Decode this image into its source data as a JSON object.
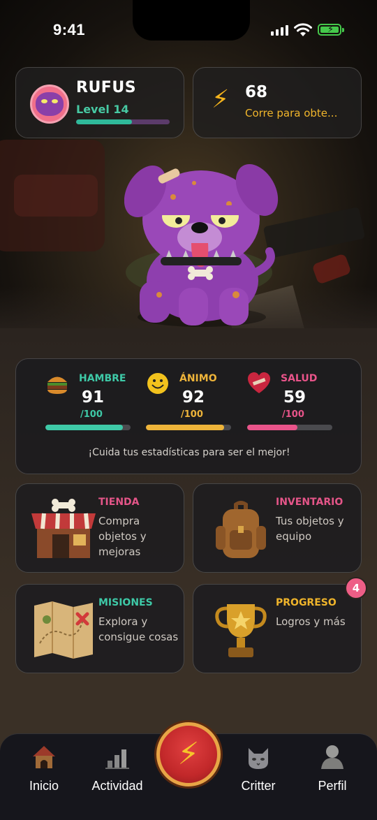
{
  "status_bar": {
    "time": "9:41"
  },
  "pet": {
    "name": "RUFUS",
    "level_label": "Level 14",
    "level_progress": 0.6
  },
  "energy": {
    "value": "68",
    "subtitle": "Corre para obte..."
  },
  "stats": [
    {
      "label": "HAMBRE",
      "value": "91",
      "max": "/100",
      "fraction": 0.91,
      "color": "#3ec9a7",
      "icon": "burger-icon"
    },
    {
      "label": "ÁNIMO",
      "value": "92",
      "max": "/100",
      "fraction": 0.92,
      "color": "#eeb43a",
      "icon": "smiley-icon"
    },
    {
      "label": "SALUD",
      "value": "59",
      "max": "/100",
      "fraction": 0.59,
      "color": "#e9548a",
      "icon": "heart-icon"
    }
  ],
  "stats_message": "¡Cuida tus estadísticas para ser el mejor!",
  "tiles": {
    "tienda": {
      "title": "TIENDA",
      "desc": "Compra objetos y mejoras",
      "color": "#e45588"
    },
    "inventario": {
      "title": "INVENTARIO",
      "desc": "Tus objetos y equipo",
      "color": "#e45588"
    },
    "misiones": {
      "title": "MISIONES",
      "desc": "Explora y consigue cosas",
      "color": "#3ec9a7"
    },
    "progreso": {
      "title": "PROGRESO",
      "desc": "Logros y más",
      "color": "#f0b52b",
      "badge": "4"
    }
  },
  "nav": [
    {
      "label": "Inicio",
      "icon": "doghouse-icon"
    },
    {
      "label": "Actividad",
      "icon": "bar-chart-icon"
    },
    {
      "label": "Critter",
      "icon": "cat-icon"
    },
    {
      "label": "Perfil",
      "icon": "person-icon"
    }
  ]
}
